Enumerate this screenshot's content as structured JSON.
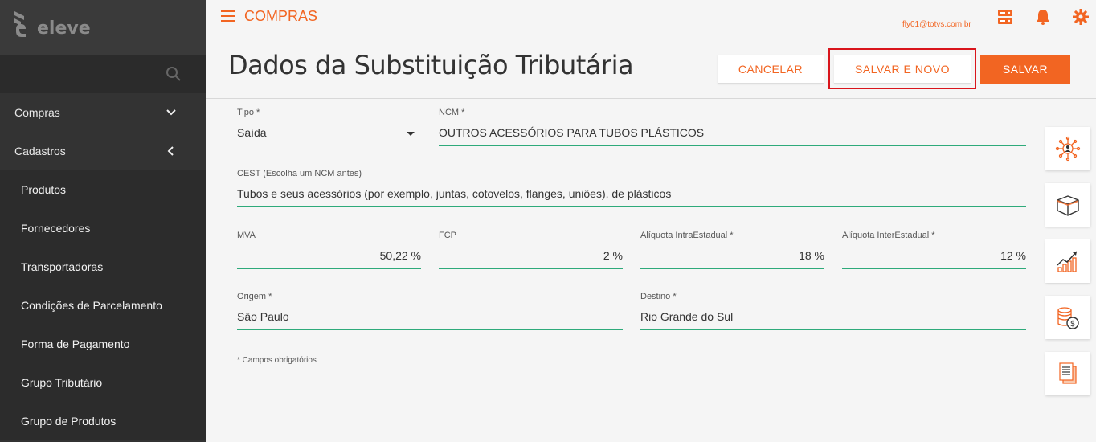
{
  "app": {
    "logo_text": "eleve",
    "module": "COMPRAS",
    "user_email": "fly01@totvs.com.br"
  },
  "sidebar": {
    "search_icon": "search-icon",
    "sections": [
      {
        "label": "Compras",
        "icon": "chevron-down-icon"
      },
      {
        "label": "Cadastros",
        "icon": "chevron-left-icon"
      }
    ],
    "items": [
      {
        "label": "Produtos"
      },
      {
        "label": "Fornecedores"
      },
      {
        "label": "Transportadoras"
      },
      {
        "label": "Condições de Parcelamento"
      },
      {
        "label": "Forma de Pagamento"
      },
      {
        "label": "Grupo Tributário"
      },
      {
        "label": "Grupo de Produtos"
      }
    ]
  },
  "topbar": {
    "icons": [
      "server-icon",
      "bell-icon",
      "gear-icon"
    ]
  },
  "header": {
    "title": "Dados da Substituição Tributária",
    "cancel_label": "CANCELAR",
    "save_new_label": "SALVAR E NOVO",
    "save_label": "SALVAR"
  },
  "form": {
    "tipo": {
      "label": "Tipo *",
      "value": "Saída"
    },
    "ncm": {
      "label": "NCM *",
      "value": "OUTROS ACESSÓRIOS PARA TUBOS PLÁSTICOS"
    },
    "cest": {
      "label": "CEST (Escolha um NCM antes)",
      "value": "Tubos e seus acessórios (por exemplo, juntas, cotovelos, flanges, uniões), de plásticos"
    },
    "mva": {
      "label": "MVA",
      "value": "50,22 %"
    },
    "fcp": {
      "label": "FCP",
      "value": "2 %"
    },
    "aliquota_intra": {
      "label": "Alíquota IntraEstadual *",
      "value": "18 %"
    },
    "aliquota_inter": {
      "label": "Alíquota InterEstadual *",
      "value": "12 %"
    },
    "origem": {
      "label": "Origem *",
      "value": "São Paulo"
    },
    "destino": {
      "label": "Destino *",
      "value": "Rio Grande do Sul"
    },
    "required_note": "* Campos obrigatórios"
  },
  "side_tools": [
    "network-people-icon",
    "box-icon",
    "growth-chart-icon",
    "coins-icon",
    "documents-icon"
  ],
  "colors": {
    "accent": "#f26522",
    "field_line": "#2eaa7a",
    "sidebar_bg": "#333333",
    "highlight": "#d9151c"
  }
}
